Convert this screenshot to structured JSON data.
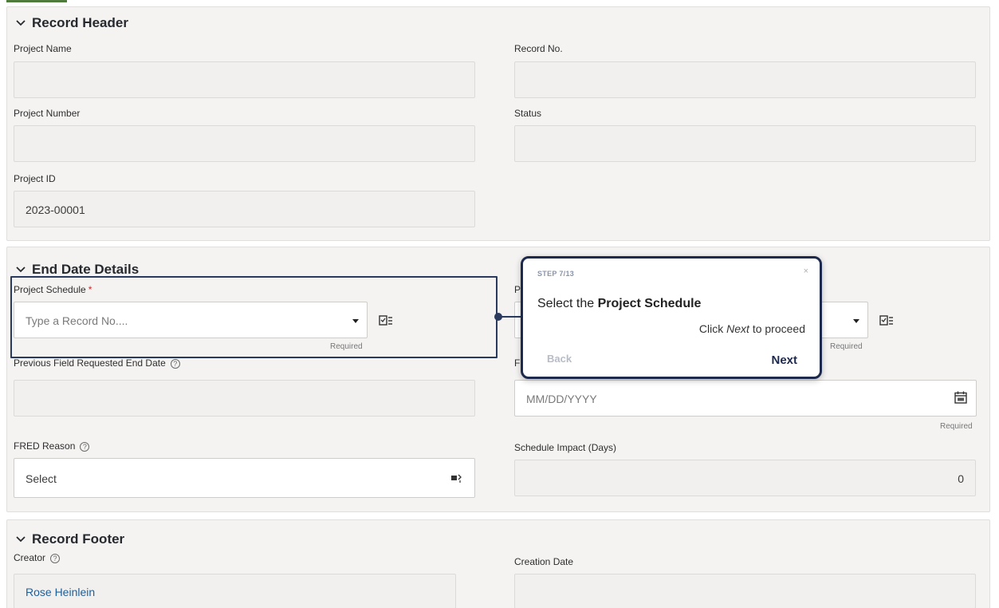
{
  "record_header": {
    "title": "Record Header",
    "project_name_label": "Project Name",
    "record_no_label": "Record No.",
    "project_number_label": "Project Number",
    "status_label": "Status",
    "project_id_label": "Project ID",
    "project_id_value": "2023-00001"
  },
  "end_date_details": {
    "title": "End Date Details",
    "project_schedule_label": "Project Schedule",
    "required_star": "*",
    "project_schedule_placeholder": "Type a Record No....",
    "required_hint": "Required",
    "previous_fred_label": "Previous Field Requested End Date",
    "date_placeholder": "MM/DD/YYYY",
    "fred_reason_label": "FRED Reason",
    "fred_reason_value": "Select",
    "schedule_impact_label": "Schedule Impact (Days)",
    "schedule_impact_value": "0",
    "right_label_fragment_1": "P",
    "right_label_fragment_2": "F"
  },
  "record_footer": {
    "title": "Record Footer",
    "creator_label": "Creator",
    "creator_value": "Rose Heinlein",
    "creation_date_label": "Creation Date"
  },
  "tour": {
    "step": "STEP 7/13",
    "close": "×",
    "title_prefix": "Select the ",
    "title_bold": "Project Schedule",
    "sub_prefix": "Click ",
    "sub_italic": "Next",
    "sub_suffix": " to proceed",
    "back": "Back",
    "next": "Next"
  },
  "icons": {
    "chevron": "chevron-down-icon",
    "help": "help-circle-icon",
    "lookup": "lookup-list-icon",
    "calendar": "calendar-icon",
    "select": "select-picker-icon"
  },
  "colors": {
    "tour_border": "#1d2a4d",
    "required_star": "#c7262a",
    "link": "#1f5f99"
  }
}
